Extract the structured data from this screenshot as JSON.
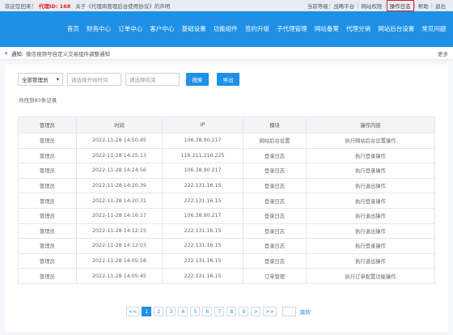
{
  "topbar": {
    "welcome": "欢迎您回来！",
    "agent_id": "代理ID: 168",
    "notice": "关于《代理商管理后台使用协议》的声明",
    "links": [
      "当前等级：战略平台",
      "网站权限",
      "操作日志",
      "帮助",
      "退出"
    ]
  },
  "nav": {
    "items": [
      "首页",
      "财务中心",
      "订单中心",
      "客户中心",
      "基础设置",
      "功能组件",
      "签约升级",
      "子代理管理",
      "网站备案",
      "代理分销",
      "网站后台设置",
      "常见问题"
    ]
  },
  "noticebar": {
    "label": "通知:",
    "text": "微信视频号自定义交易组件调整通知",
    "more": "更多"
  },
  "filters": {
    "admin_select": "全部管理员",
    "start_placeholder": "请选择开始时间",
    "end_placeholder": "请选择结束",
    "search": "搜索",
    "export": "导出"
  },
  "total": "共找到83条记录",
  "table": {
    "headers": [
      "管理员",
      "时间",
      "IP",
      "模块",
      "操作内容"
    ],
    "rows": [
      [
        "管理员",
        "2022-11-28 14:50:45",
        "106.38.90.217",
        "网站后台设置",
        "执行网站后台设置操作"
      ],
      [
        "管理员",
        "2022-11-28 14:25:13",
        "116.211.216.225",
        "登录日志",
        "执行登录操作"
      ],
      [
        "管理员",
        "2022-11-28 14:24:56",
        "106.38.90.217",
        "登录日志",
        "执行登录操作"
      ],
      [
        "管理员",
        "2022-11-28 14:20:39",
        "222.131.16.15",
        "登录日志",
        "执行退出操作"
      ],
      [
        "管理员",
        "2022-11-28 14:20:31",
        "222.131.16.15",
        "登录日志",
        "执行登录操作"
      ],
      [
        "管理员",
        "2022-11-28 14:16:17",
        "106.38.90.217",
        "登录日志",
        "执行退出操作"
      ],
      [
        "管理员",
        "2022-11-28 14:12:15",
        "222.131.16.15",
        "登录日志",
        "执行退出操作"
      ],
      [
        "管理员",
        "2022-11-28 14:12:03",
        "222.131.16.15",
        "登录日志",
        "执行登录操作"
      ],
      [
        "管理员",
        "2022-11-28 14:05:58",
        "222.131.16.15",
        "登录日志",
        "执行退出操作"
      ],
      [
        "管理员",
        "2022-11-28 14:05:45",
        "222.131.16.15",
        "订单管理",
        "执行订单配置功能操作"
      ]
    ]
  },
  "pager": {
    "first": "<<",
    "pages": [
      "1",
      "2",
      "3",
      "4",
      "5",
      "6",
      "7",
      "8",
      "9"
    ],
    "next": ">",
    "last": ">>",
    "goto": "跳转"
  }
}
